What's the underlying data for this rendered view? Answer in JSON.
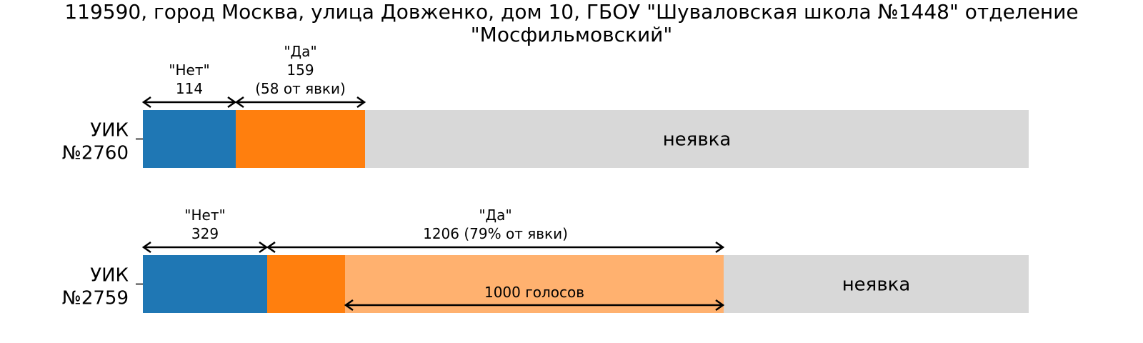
{
  "colors": {
    "no": "#1f77b4",
    "yes": "#ff7f0e",
    "excess": "#ffb16f",
    "abstain": "#d8d8d8"
  },
  "chart_data": {
    "type": "bar",
    "orientation": "horizontal",
    "stacked": true,
    "title_lines": [
      "119590, город Москва, улица Довженко, дом 10, ГБОУ \"Шуваловская школа №1448\" отделение",
      "\"Мосфильмовский\""
    ],
    "xlim": [
      0,
      1425
    ],
    "grid": false,
    "categories": [
      {
        "label_lines": [
          "УИК",
          "№2760"
        ],
        "no": 114,
        "yes": 159,
        "no_label": [
          "\"Нет\"",
          "114"
        ],
        "yes_label": [
          "\"Да\"",
          "159",
          "(58 от явки)"
        ],
        "yes_real": null,
        "excess_label": null,
        "abstain_label": "неявка"
      },
      {
        "label_lines": [
          "УИК",
          "№2759"
        ],
        "no": 329,
        "yes": 1206,
        "no_label": [
          "\"Нет\"",
          "329"
        ],
        "yes_label": [
          "\"Да\"",
          "1206 (79% от явки)"
        ],
        "yes_real": 206,
        "excess": 1000,
        "excess_label": "1000 голосов",
        "abstain_label": "неявка"
      }
    ],
    "pixel_unit_hint": "bars drawn in vote units on a shared scale"
  }
}
